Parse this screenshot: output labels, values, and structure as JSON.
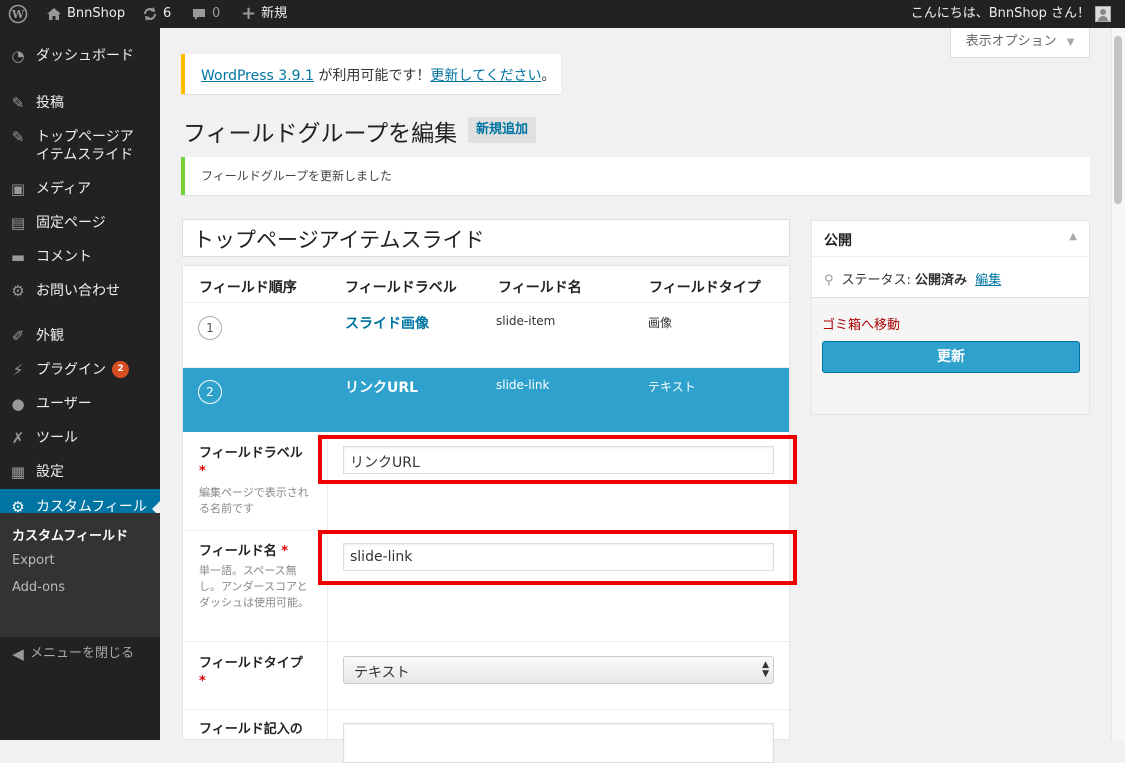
{
  "admin_bar": {
    "site_name": "BnnShop",
    "updates_count": "6",
    "comments_count": "0",
    "new_label": "新規",
    "greeting": "こんにちは、BnnShop さん！"
  },
  "sidebar": {
    "items": [
      {
        "label": "ダッシュボード",
        "icon": "dashboard-icon"
      },
      {
        "label": "投稿",
        "icon": "pin-icon"
      },
      {
        "label": "トップページアイテムスライド",
        "icon": "pin-icon"
      },
      {
        "label": "メディア",
        "icon": "media-icon"
      },
      {
        "label": "固定ページ",
        "icon": "page-icon"
      },
      {
        "label": "コメント",
        "icon": "comment-icon"
      },
      {
        "label": "お問い合わせ",
        "icon": "gear-icon"
      },
      {
        "label": "外観",
        "icon": "brush-icon"
      },
      {
        "label": "プラグイン",
        "icon": "plugin-icon",
        "badge": "2"
      },
      {
        "label": "ユーザー",
        "icon": "user-icon"
      },
      {
        "label": "ツール",
        "icon": "wrench-icon"
      },
      {
        "label": "設定",
        "icon": "settings-icon"
      },
      {
        "label": "カスタムフィールド",
        "icon": "gear-icon"
      }
    ],
    "submenu": [
      {
        "label": "カスタムフィールド"
      },
      {
        "label": "Export"
      },
      {
        "label": "Add-ons"
      }
    ],
    "collapse_label": "メニューを閉じる"
  },
  "screen_options": {
    "label": "表示オプション"
  },
  "update_nag": {
    "link_version": "WordPress 3.9.1",
    "middle_text": " が利用可能です！",
    "link_update": "更新してください",
    "end_text": "。"
  },
  "page": {
    "title": "フィールドグループを編集",
    "add_new": "新規追加",
    "updated_message": "フィールドグループを更新しました",
    "group_title": "トップページアイテムスライド"
  },
  "fields_table": {
    "headers": [
      "フィールド順序",
      "フィールドラベル",
      "フィールド名",
      "フィールドタイプ"
    ],
    "rows": [
      {
        "order": "1",
        "label": "スライド画像",
        "name": "slide-item",
        "type": "画像"
      },
      {
        "order": "2",
        "label": "リンクURL",
        "name": "slide-link",
        "type": "テキスト"
      }
    ]
  },
  "field_form": {
    "label_field": {
      "label": "フィールドラベル",
      "required": "*",
      "desc": "編集ページで表示される名前です",
      "value": "リンクURL"
    },
    "name_field": {
      "label": "フィールド名",
      "required": "*",
      "desc": "単一語。スペース無し。アンダースコアとダッシュは使用可能。",
      "value": "slide-link"
    },
    "type_field": {
      "label": "フィールドタイプ",
      "required": "*",
      "value": "テキスト"
    },
    "instructions_field": {
      "label": "フィールド記入の"
    }
  },
  "publish_box": {
    "title": "公開",
    "status_label": "ステータス: ",
    "status_value": "公開済み",
    "edit_link": "編集",
    "trash_link": "ゴミ箱へ移動",
    "update_button": "更新"
  }
}
